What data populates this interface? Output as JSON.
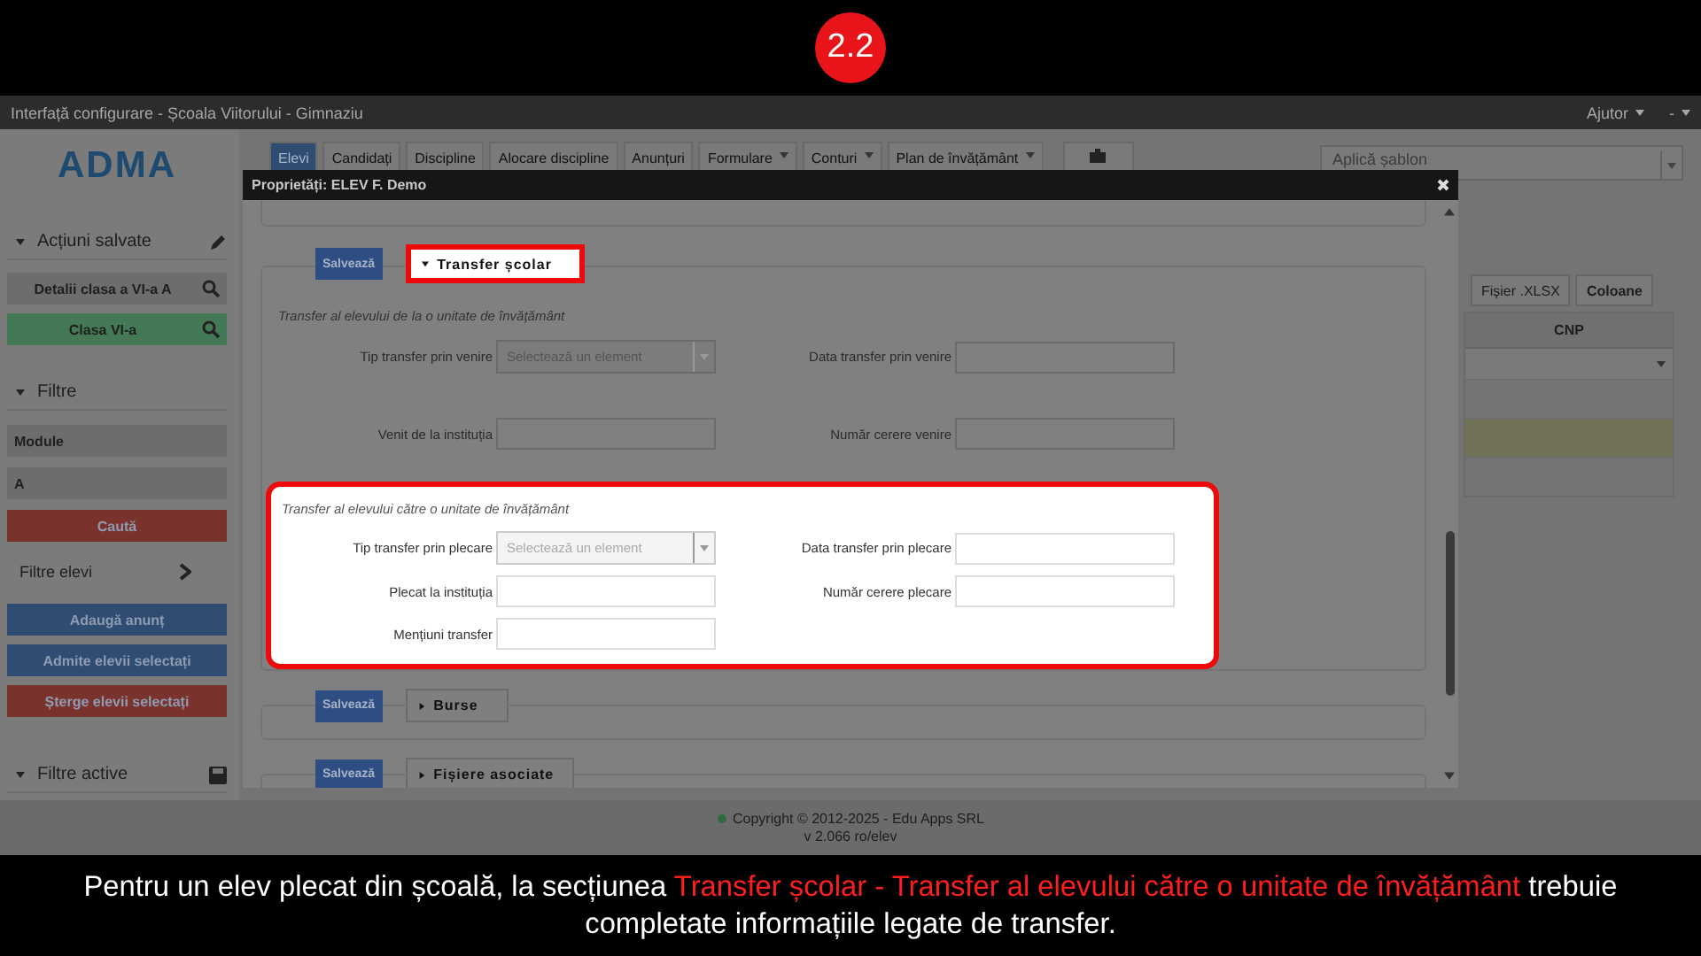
{
  "badge": "2.2",
  "app": {
    "title": "Interfață configurare - Școala Viitorului - Gimnaziu",
    "menu": [
      {
        "label": "Ajutor"
      },
      {
        "label": "-"
      }
    ]
  },
  "sidebar": {
    "logo": "ADMA",
    "saved_actions": {
      "title": "Acțiuni salvate",
      "items": [
        {
          "label": "Detalii clasa a VI-a A",
          "kind": "neutral"
        },
        {
          "label": "Clasa VI-a",
          "kind": "success"
        }
      ]
    },
    "filters": {
      "title": "Filtre",
      "fields": [
        {
          "value": "Module"
        },
        {
          "value": "A"
        }
      ],
      "search_button": "Caută"
    },
    "student_filters": "Filtre elevi",
    "actions": [
      {
        "label": "Adaugă anunț",
        "kind": "primary"
      },
      {
        "label": "Admite elevii selectați",
        "kind": "primary"
      },
      {
        "label": "Șterge elevii selectați",
        "kind": "danger"
      }
    ],
    "active_filters": "Filtre active"
  },
  "nav_tabs": [
    {
      "label": "Elevi",
      "selected": true,
      "dropdown": false
    },
    {
      "label": "Candidați",
      "selected": false,
      "dropdown": false
    },
    {
      "label": "Discipline",
      "selected": false,
      "dropdown": false
    },
    {
      "label": "Alocare discipline",
      "selected": false,
      "dropdown": false
    },
    {
      "label": "Anunțuri",
      "selected": false,
      "dropdown": false
    },
    {
      "label": "Formulare",
      "selected": false,
      "dropdown": true
    },
    {
      "label": "Conturi",
      "selected": false,
      "dropdown": true
    },
    {
      "label": "Plan de învățământ",
      "selected": false,
      "dropdown": true
    }
  ],
  "template_select": {
    "placeholder": "Aplică șablon"
  },
  "toolbar": [
    {
      "label": "Fișier .XLSX",
      "bold": false
    },
    {
      "label": "Coloane",
      "bold": true
    }
  ],
  "table": {
    "columns": [
      "CNP"
    ],
    "rows": [
      {
        "highlighted": false
      },
      {
        "highlighted": true
      },
      {
        "highlighted": false
      }
    ]
  },
  "modal": {
    "title": "Proprietăți: ELEV F. Demo",
    "sections": [
      {
        "title": "Transfer școlar",
        "save": "Salvează",
        "expanded": true,
        "emphasized": true,
        "groups": [
          {
            "title": "Transfer al elevului de la o unitate de învățământ",
            "emphasized": false,
            "fields": [
              {
                "label": "Tip transfer prin venire",
                "kind": "select",
                "placeholder": "Selectează un element"
              },
              {
                "label": "Data transfer prin venire",
                "kind": "text"
              },
              {
                "label": "Venit de la instituția",
                "kind": "text"
              },
              {
                "label": "Număr cerere venire",
                "kind": "text"
              }
            ]
          },
          {
            "title": "Transfer al elevului către o unitate de învățământ",
            "emphasized": true,
            "fields": [
              {
                "label": "Tip transfer prin plecare",
                "kind": "select",
                "placeholder": "Selectează un element"
              },
              {
                "label": "Data transfer prin plecare",
                "kind": "text"
              },
              {
                "label": "Plecat la instituția",
                "kind": "text"
              },
              {
                "label": "Număr cerere plecare",
                "kind": "text"
              },
              {
                "label": "Mențiuni transfer",
                "kind": "text"
              }
            ]
          }
        ]
      },
      {
        "title": "Burse",
        "save": "Salvează",
        "expanded": false,
        "emphasized": false
      },
      {
        "title": "Fișiere asociate",
        "save": "Salvează",
        "expanded": false,
        "emphasized": false
      }
    ]
  },
  "footer": {
    "copyright": "Copyright © 2012-2025 - Edu Apps SRL",
    "version": "v 2.066 ro/elev"
  },
  "caption": [
    {
      "text": "Pentru un elev plecat din școală, la secțiunea ",
      "emphasized": false
    },
    {
      "text": "Transfer școlar - Transfer al elevului către o unitate de învățământ",
      "emphasized": true
    },
    {
      "text": " trebuie completate informațiile legate de transfer.",
      "emphasized": false
    }
  ]
}
